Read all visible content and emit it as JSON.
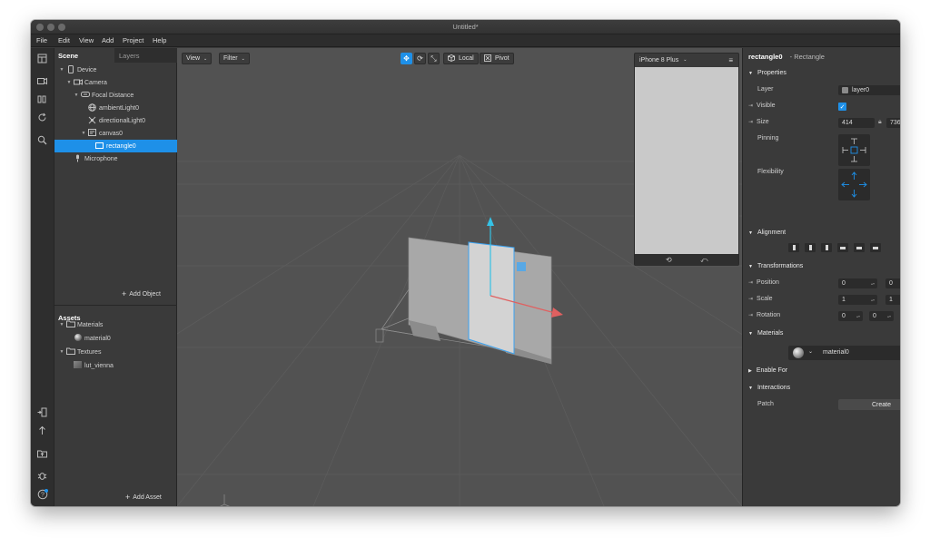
{
  "window": {
    "title": "Untitled*"
  },
  "menu": [
    "File",
    "Edit",
    "View",
    "Add",
    "Project",
    "Help"
  ],
  "left_panel": {
    "tabs": {
      "scene": "Scene",
      "layers": "Layers"
    },
    "scene_tree": [
      {
        "label": "Device",
        "icon": "device-icon"
      },
      {
        "label": "Camera",
        "icon": "camera-icon"
      },
      {
        "label": "Focal Distance",
        "icon": "focal-distance-icon"
      },
      {
        "label": "ambientLight0",
        "icon": "ambient-light-icon"
      },
      {
        "label": "directionalLight0",
        "icon": "directional-light-icon"
      },
      {
        "label": "canvas0",
        "icon": "canvas-icon"
      },
      {
        "label": "rectangle0",
        "icon": "rectangle-icon",
        "selected": true
      },
      {
        "label": "Microphone",
        "icon": "microphone-icon"
      }
    ],
    "add_object": "Add Object",
    "assets_title": "Assets",
    "assets_tree": [
      {
        "label": "Materials",
        "icon": "folder-icon"
      },
      {
        "label": "material0",
        "icon": "material-sphere-icon"
      },
      {
        "label": "Textures",
        "icon": "folder-icon"
      },
      {
        "label": "lut_vienna",
        "icon": "texture-icon"
      }
    ],
    "add_asset": "Add Asset"
  },
  "viewport": {
    "view_label": "View",
    "filter_label": "Filter",
    "local_label": "Local",
    "pivot_label": "Pivot",
    "device_preview": "iPhone 8 Plus"
  },
  "inspector": {
    "object_name": "rectangle0",
    "object_type": "- Rectangle",
    "sections": {
      "properties": "Properties",
      "alignment": "Alignment",
      "transformations": "Transformations",
      "materials": "Materials",
      "enable_for": "Enable For",
      "interactions": "Interactions"
    },
    "layer_label": "Layer",
    "layer_value": "layer0",
    "visible_label": "Visible",
    "visible": true,
    "size_label": "Size",
    "size_w": "414",
    "size_h": "736",
    "pinning_label": "Pinning",
    "flexibility_label": "Flexibility",
    "position_label": "Position",
    "position": [
      "0",
      "0"
    ],
    "scale_label": "Scale",
    "scale": [
      "1",
      "1"
    ],
    "rotation_label": "Rotation",
    "rotation": [
      "0",
      "0",
      "0"
    ],
    "material_value": "material0",
    "patch_label": "Patch",
    "create_label": "Create"
  },
  "colors": {
    "accent": "#1e90e8",
    "panel": "#3a3a3a",
    "viewport": "#525252"
  }
}
